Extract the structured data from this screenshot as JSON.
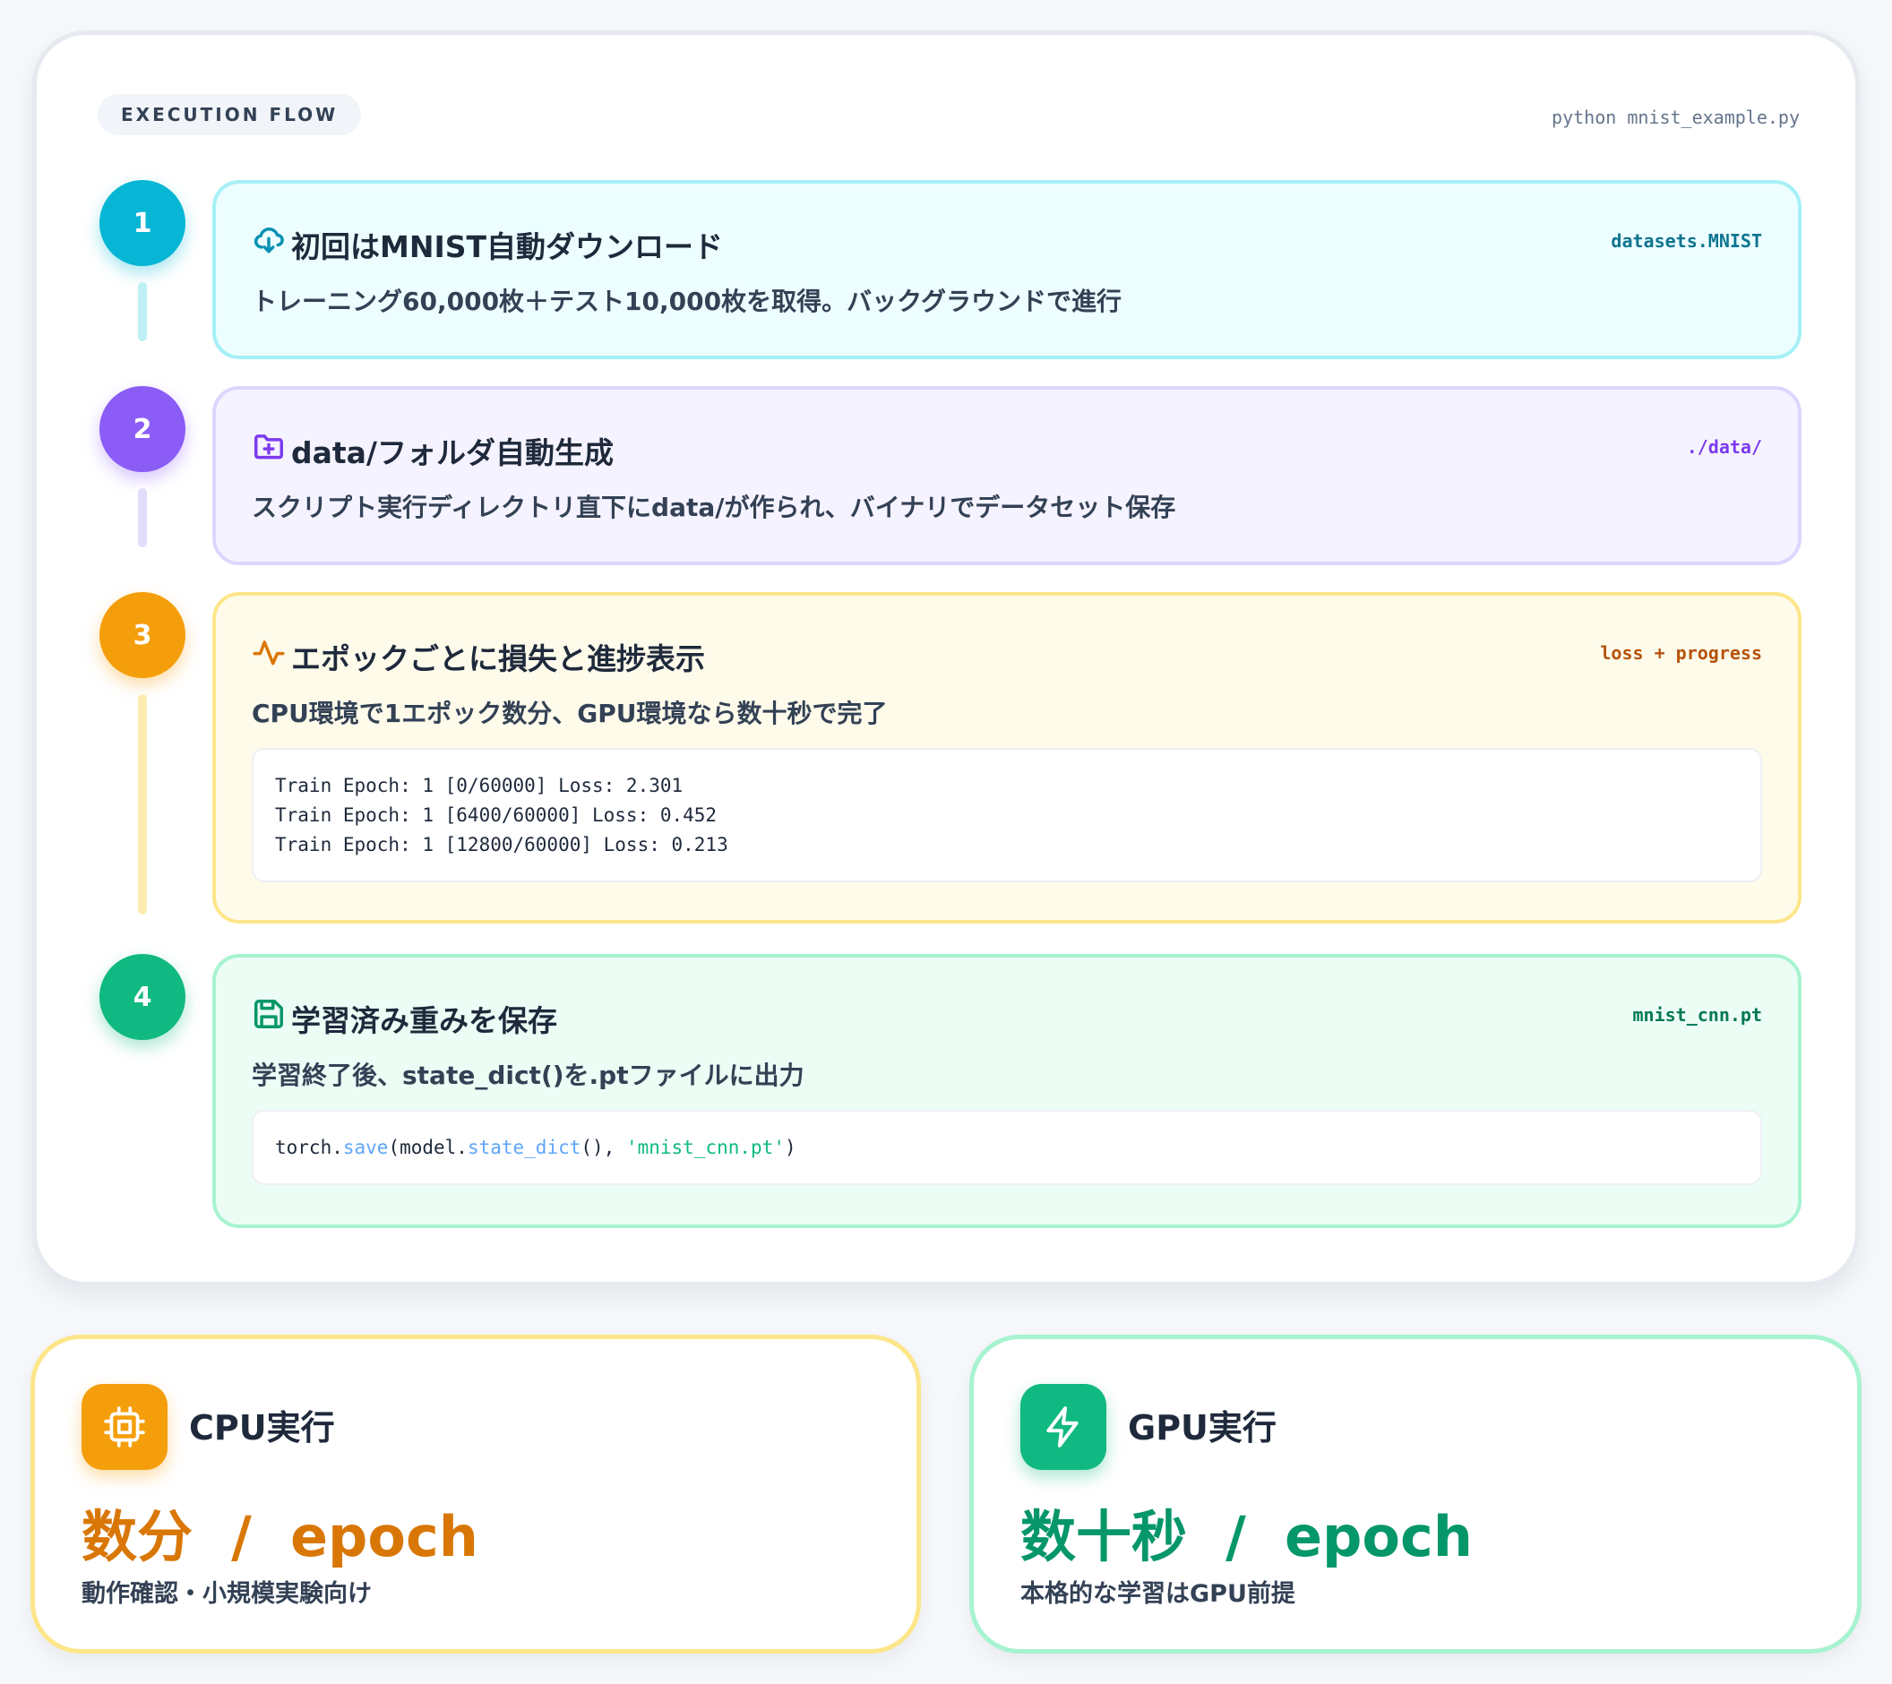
{
  "flow": {
    "tag": "EXECUTION FLOW",
    "command": "python mnist_example.py"
  },
  "steps": [
    {
      "number": "1",
      "title": "初回はMNIST自動ダウンロード",
      "tag": "datasets.MNIST",
      "description": "トレーニング60,000枚＋テスト10,000枚を取得。バックグラウンドで進行",
      "icon": "cloud-download-icon",
      "color": "#06b6d4"
    },
    {
      "number": "2",
      "title": "data/フォルダ自動生成",
      "tag": "./data/",
      "description": "スクリプト実行ディレクトリ直下にdata/が作られ、バイナリでデータセット保存",
      "icon": "folder-plus-icon",
      "color": "#8b5cf6"
    },
    {
      "number": "3",
      "title": "エポックごとに損失と進捗表示",
      "tag": "loss + progress",
      "description": "CPU環境で1エポック数分、GPU環境なら数十秒で完了",
      "icon": "activity-icon",
      "color": "#f59e0b",
      "log_lines": [
        "Train Epoch: 1 [0/60000] Loss: 2.301",
        "Train Epoch: 1 [6400/60000] Loss: 0.452",
        "Train Epoch: 1 [12800/60000] Loss: 0.213"
      ]
    },
    {
      "number": "4",
      "title": "学習済み重みを保存",
      "tag": "mnist_cnn.pt",
      "description": "学習終了後、state_dict()を.ptファイルに出力",
      "icon": "save-icon",
      "color": "#10b981",
      "code": {
        "t1": "torch.",
        "fn1": "save",
        "t2": "(model.",
        "fn2": "state_dict",
        "t3": "(), ",
        "str": "'mnist_cnn.pt'",
        "t4": ")"
      }
    }
  ],
  "cpu": {
    "title": "CPU実行",
    "speed": "数分  /  epoch",
    "note": "動作確認・小規模実験向け",
    "icon": "cpu-chip-icon",
    "color": "#f59e0b"
  },
  "gpu": {
    "title": "GPU実行",
    "speed": "数十秒  /  epoch",
    "note": "本格的な学習はGPU前提",
    "icon": "lightning-bolt-icon",
    "color": "#10b981"
  }
}
